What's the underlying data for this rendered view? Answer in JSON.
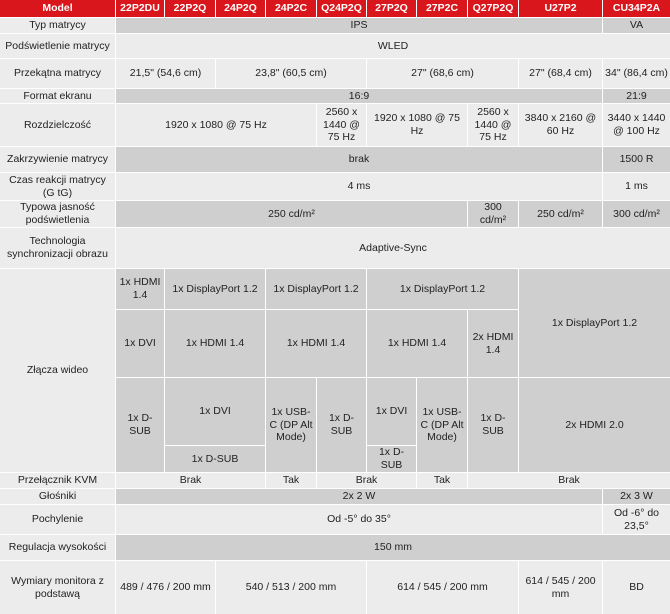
{
  "header": {
    "model": "Model",
    "models": [
      "22P2DU",
      "22P2Q",
      "24P2Q",
      "24P2C",
      "Q24P2Q",
      "27P2Q",
      "27P2C",
      "Q27P2Q",
      "U27P2",
      "CU34P2A"
    ]
  },
  "rows": {
    "typ_matrycy": {
      "label": "Typ matrycy",
      "main": "IPS",
      "last": "VA"
    },
    "podswietlenie": {
      "label": "Podświetlenie matrycy",
      "value": "WLED"
    },
    "przekatna": {
      "label": "Przekątna matrycy",
      "v1": "21,5\" (54,6 cm)",
      "v2": "23,8\" (60,5 cm)",
      "v3": "27\" (68,6 cm)",
      "v4": "27\" (68,4 cm)",
      "v5": "34\" (86,4 cm)"
    },
    "format": {
      "label": "Format ekranu",
      "main": "16:9",
      "last": "21:9"
    },
    "rozdzielczosc": {
      "label": "Rozdzielczość",
      "v1": "1920 x 1080 @ 75 Hz",
      "v2": "2560 x 1440 @ 75 Hz",
      "v3": "1920 x 1080 @ 75 Hz",
      "v4": "2560 x 1440 @ 75 Hz",
      "v5": "3840 x 2160 @ 60 Hz",
      "v6": "3440 x 1440 @ 100 Hz"
    },
    "zakrzywienie": {
      "label": "Zakrzywienie matrycy",
      "main": "brak",
      "last": "1500 R"
    },
    "czas_reakcji": {
      "label": "Czas reakcji matrycy (G tG)",
      "main": "4 ms",
      "last": "1 ms"
    },
    "jasnosc": {
      "label": "Typowa jasność podświetlenia",
      "v1": "250 cd/m²",
      "v2": "300 cd/m²",
      "v3": "250 cd/m²",
      "v4": "300 cd/m²"
    },
    "synchronizacja": {
      "label": "Technologia synchronizacji obrazu",
      "value": "Adaptive-Sync"
    },
    "zlacza": {
      "label": "Złącza wideo",
      "hdmi14": "1x HDMI 1.4",
      "dp12": "1x DisplayPort 1.2",
      "dvi": "1x DVI",
      "dsub": "1x D-SUB",
      "usbc": "1x USB-C (DP Alt Mode)",
      "hdmi14_x2": "2x HDMI 1.4",
      "hdmi20_x2": "2x HDMI 2.0"
    },
    "kvm": {
      "label": "Przełącznik KVM",
      "brak": "Brak",
      "tak": "Tak"
    },
    "glosniki": {
      "label": "Głośniki",
      "main": "2x 2 W",
      "last": "2x 3 W"
    },
    "pochylenie": {
      "label": "Pochylenie",
      "main": "Od -5° do 35°",
      "last": "Od -6° do 23,5°"
    },
    "regulacja": {
      "label": "Regulacja wysokości",
      "value": "150 mm"
    },
    "wymiary": {
      "label": "Wymiary monitora z podstawą",
      "v1": "489 / 476 / 200 mm",
      "v2": "540 / 513 / 200 mm",
      "v3": "614 / 545 / 200 mm",
      "v4": "614 / 545 / 200 mm",
      "v5": "BD"
    }
  }
}
